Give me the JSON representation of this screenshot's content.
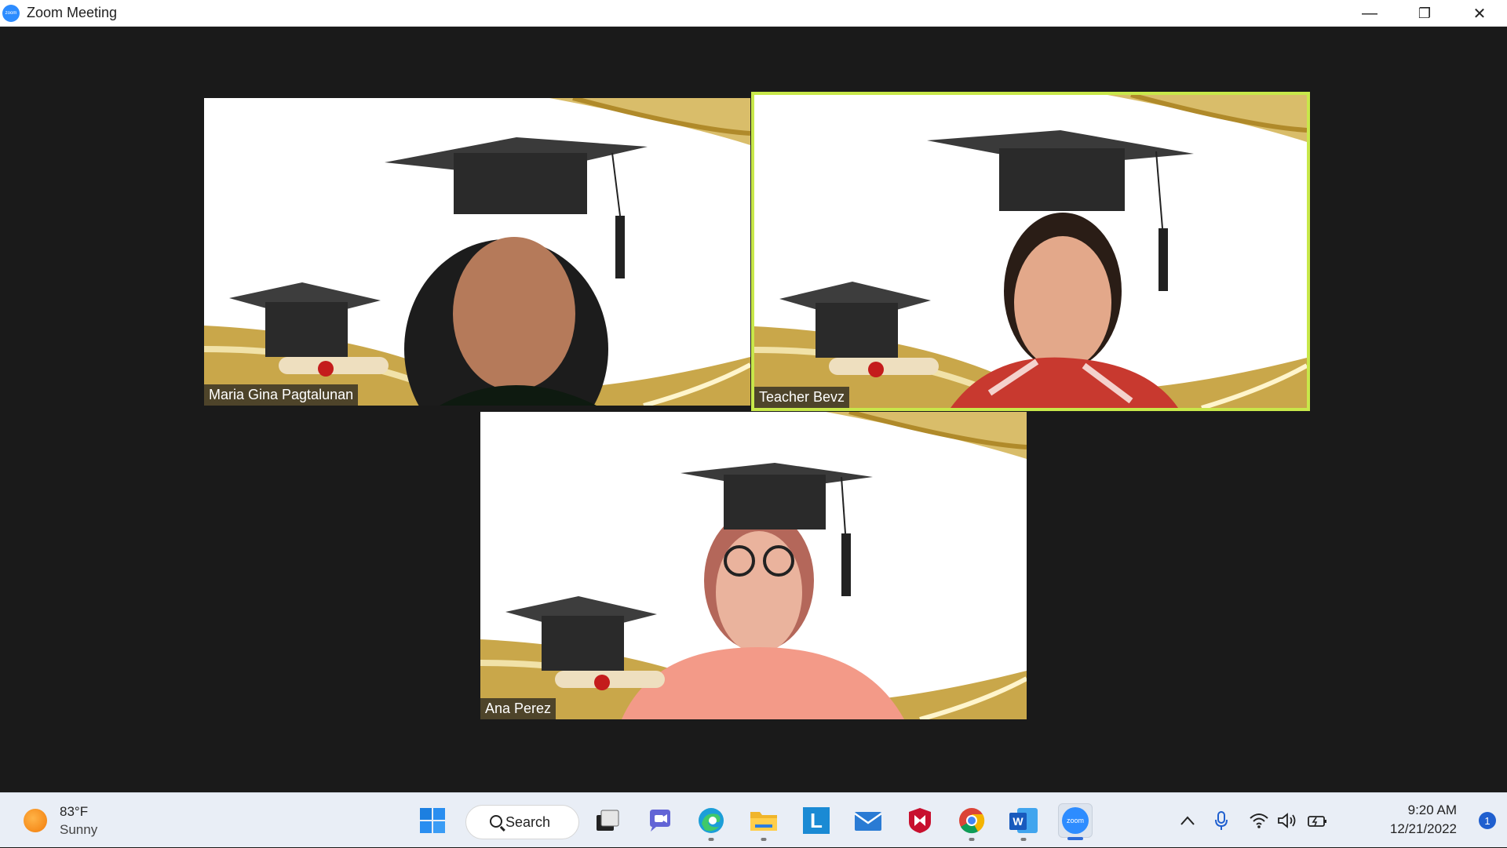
{
  "window": {
    "title": "Zoom Meeting",
    "app_icon_label": "zoom",
    "controls": {
      "minimize": "—",
      "restore": "❐",
      "close": "✕"
    }
  },
  "participants": [
    {
      "name": "Maria Gina Pagtalunan",
      "active_speaker": false
    },
    {
      "name": "Teacher Bevz",
      "active_speaker": true
    },
    {
      "name": "Ana Perez",
      "active_speaker": false
    }
  ],
  "taskbar": {
    "weather": {
      "temp": "83°F",
      "condition": "Sunny"
    },
    "search_label": "Search",
    "apps": [
      "windows-start",
      "task-view",
      "teams-chat",
      "edge",
      "file-explorer",
      "lexmark-l",
      "mail",
      "mcafee",
      "chrome",
      "word",
      "zoom"
    ],
    "zoom_icon_label": "zoom",
    "word_icon_label": "W",
    "l_icon_label": "L",
    "clock": {
      "time": "9:20 AM",
      "date": "12/21/2022"
    },
    "notification_count": "1"
  },
  "colors": {
    "active_border": "#c8e84a",
    "zoom_blue": "#2d8cff",
    "gold": "#c9a74a",
    "background": "#1a1a1a"
  }
}
